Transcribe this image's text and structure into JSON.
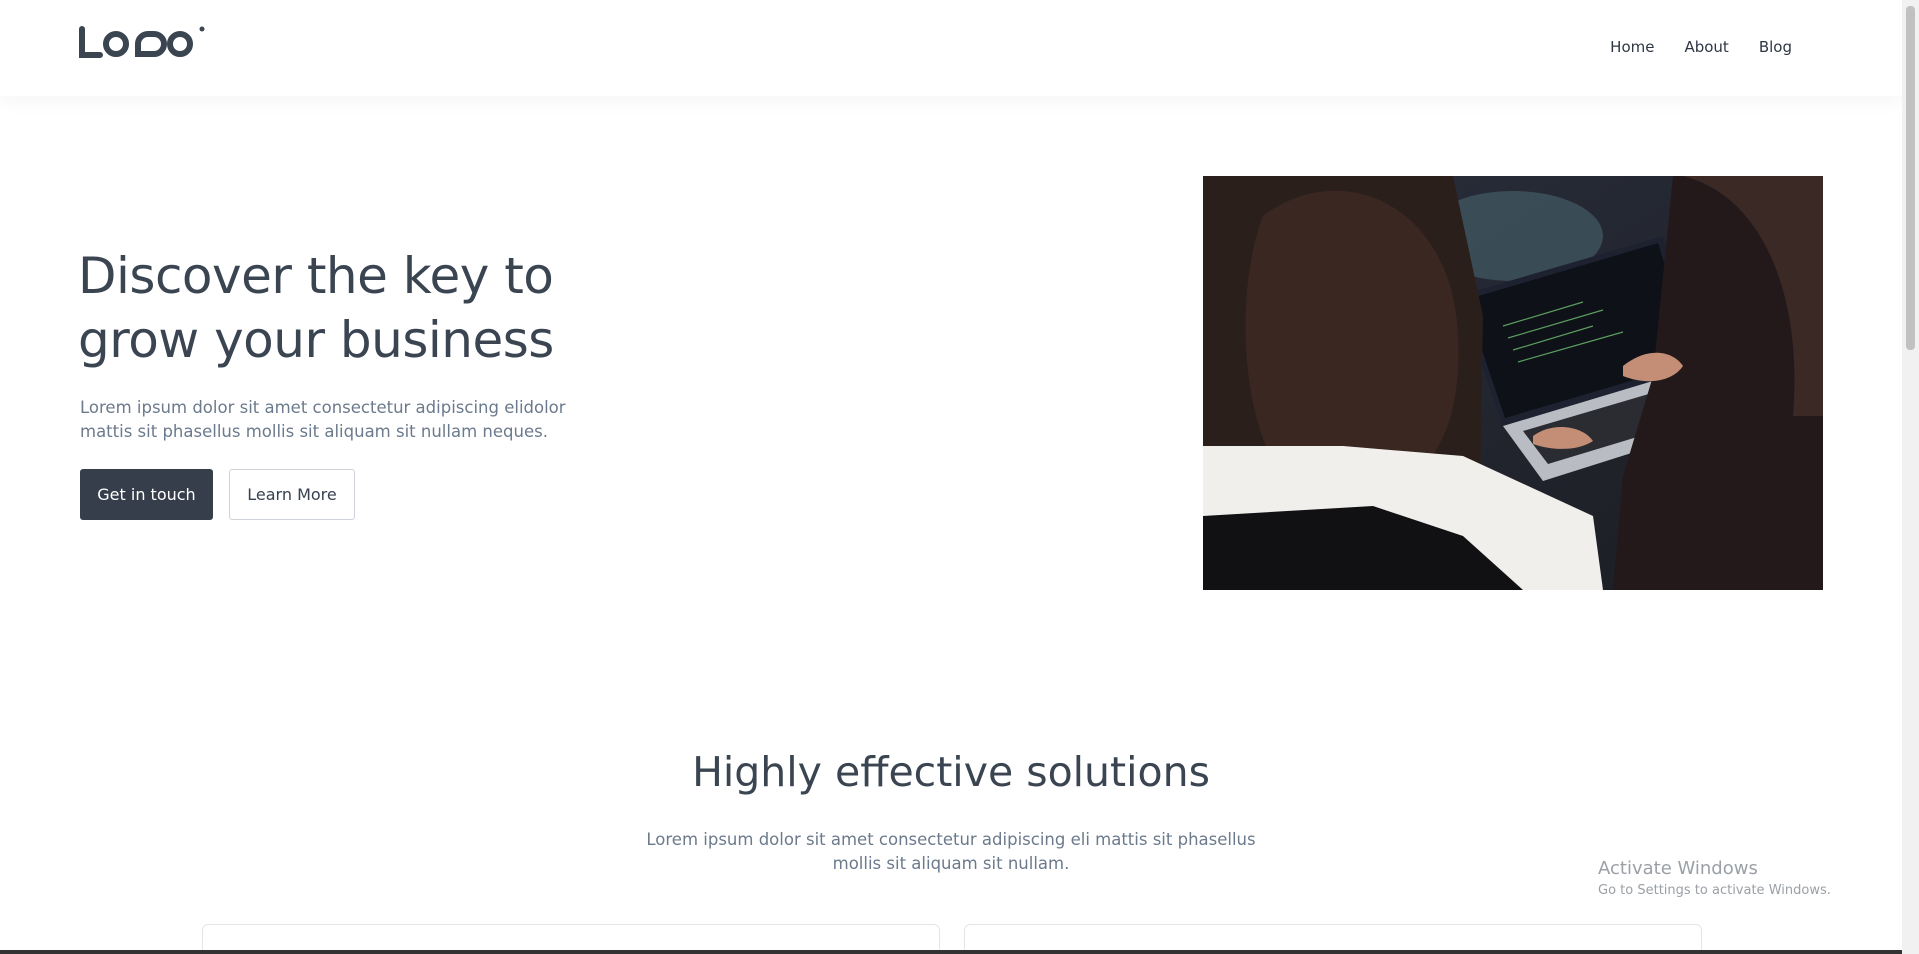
{
  "header": {
    "nav": [
      "Home",
      "About",
      "Blog"
    ]
  },
  "hero": {
    "title_line1": "Discover the key to",
    "title_line2": "grow your business",
    "description_line1": "Lorem ipsum dolor sit amet consectetur adipiscing elidolor",
    "description_line2": "mattis sit phasellus mollis sit aliquam sit nullam neques.",
    "primary_button": "Get in touch",
    "secondary_button": "Learn More"
  },
  "solutions": {
    "title": "Highly effective solutions",
    "description_line1": "Lorem ipsum dolor sit amet consectetur adipiscing eli mattis sit phasellus",
    "description_line2": "mollis sit aliquam sit nullam."
  },
  "watermark": {
    "title": "Activate Windows",
    "subtitle": "Go to Settings to activate Windows."
  }
}
